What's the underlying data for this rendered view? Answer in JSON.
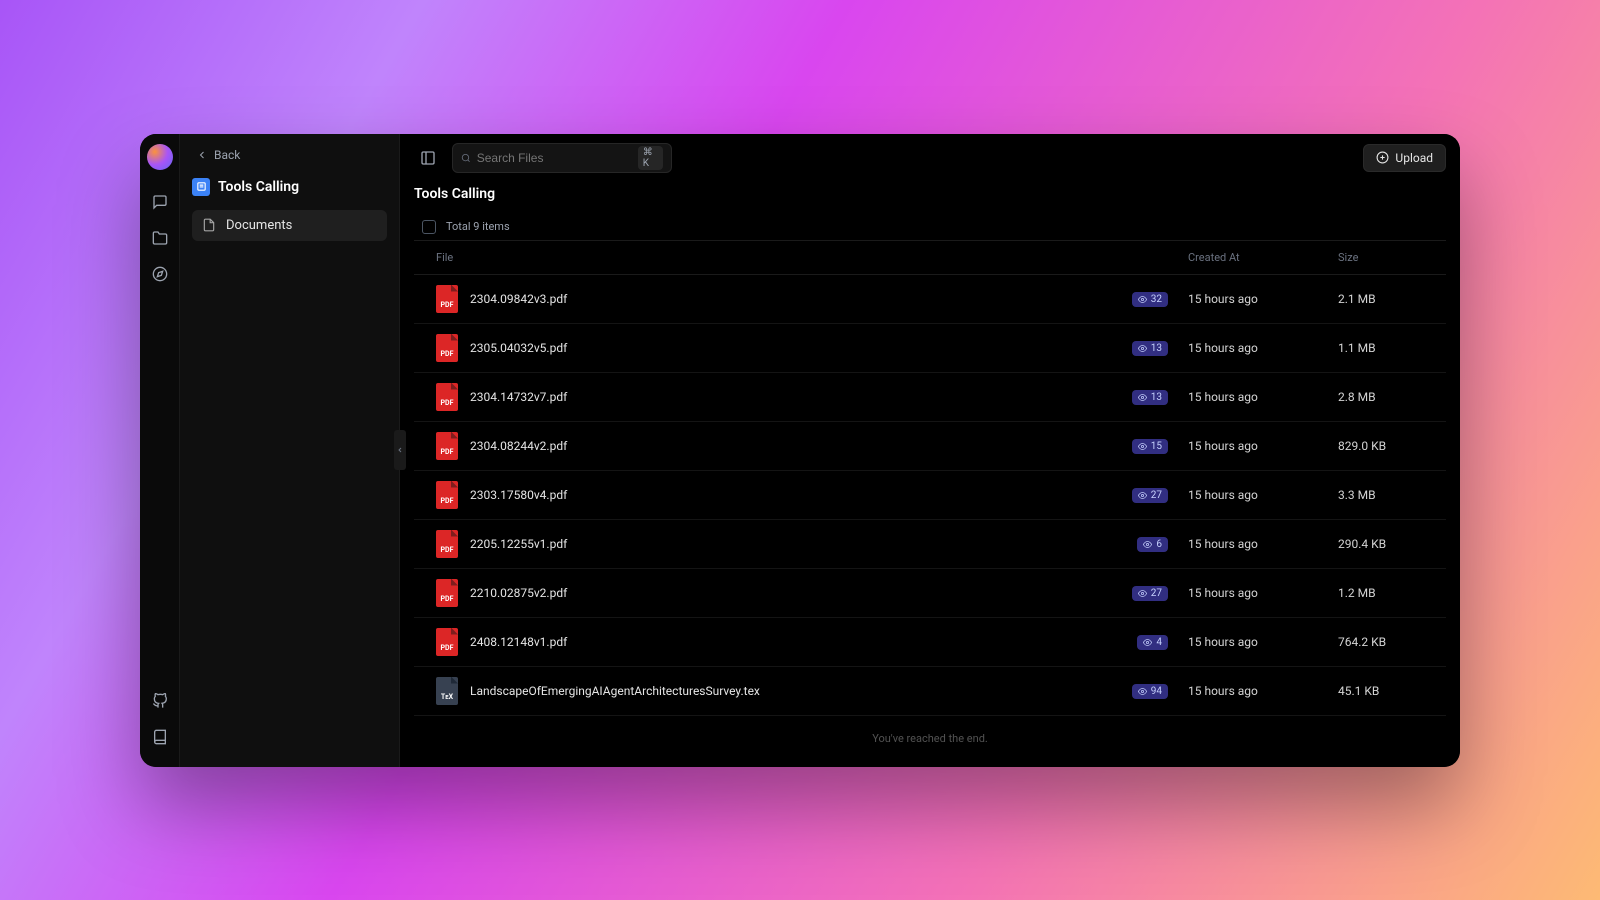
{
  "sidebar": {
    "back_label": "Back",
    "title": "Tools Calling",
    "item_label": "Documents"
  },
  "search": {
    "placeholder": "Search Files",
    "shortcut": "⌘ K"
  },
  "upload_label": "Upload",
  "page_title": "Tools Calling",
  "total_items_label": "Total 9 items",
  "columns": {
    "file": "File",
    "created": "Created At",
    "size": "Size"
  },
  "files": [
    {
      "name": "2304.09842v3.pdf",
      "type": "PDF",
      "badge": "32",
      "created": "15 hours ago",
      "size": "2.1 MB"
    },
    {
      "name": "2305.04032v5.pdf",
      "type": "PDF",
      "badge": "13",
      "created": "15 hours ago",
      "size": "1.1 MB"
    },
    {
      "name": "2304.14732v7.pdf",
      "type": "PDF",
      "badge": "13",
      "created": "15 hours ago",
      "size": "2.8 MB"
    },
    {
      "name": "2304.08244v2.pdf",
      "type": "PDF",
      "badge": "15",
      "created": "15 hours ago",
      "size": "829.0 KB"
    },
    {
      "name": "2303.17580v4.pdf",
      "type": "PDF",
      "badge": "27",
      "created": "15 hours ago",
      "size": "3.3 MB"
    },
    {
      "name": "2205.12255v1.pdf",
      "type": "PDF",
      "badge": "6",
      "created": "15 hours ago",
      "size": "290.4 KB"
    },
    {
      "name": "2210.02875v2.pdf",
      "type": "PDF",
      "badge": "27",
      "created": "15 hours ago",
      "size": "1.2 MB"
    },
    {
      "name": "2408.12148v1.pdf",
      "type": "PDF",
      "badge": "4",
      "created": "15 hours ago",
      "size": "764.2 KB"
    },
    {
      "name": "LandscapeOfEmergingAIAgentArchitecturesSurvey.tex",
      "type": "TEX",
      "badge": "94",
      "created": "15 hours ago",
      "size": "45.1 KB"
    }
  ],
  "end_label": "You've reached the end."
}
